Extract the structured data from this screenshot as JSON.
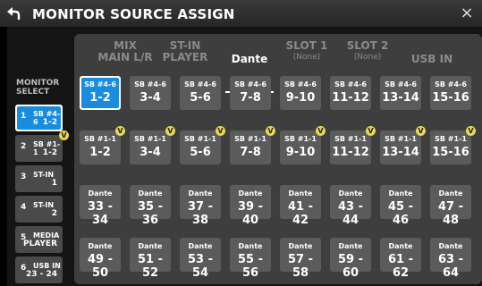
{
  "header": {
    "title": "MONITOR SOURCE ASSIGN",
    "close_glyph": "×",
    "back_icon": "back-arrow-icon"
  },
  "tabs": {
    "mix": {
      "l1": "MIX",
      "l2": "MAIN L/R"
    },
    "stin": {
      "l1": "ST-IN",
      "l2": "PLAYER"
    },
    "dante": {
      "l1": "Dante"
    },
    "slot1": {
      "l1": "SLOT 1",
      "l2": "(None)"
    },
    "slot2": {
      "l1": "SLOT 2",
      "l2": "(None)"
    },
    "usb": {
      "l1": "USB IN"
    }
  },
  "monitor_select": {
    "title_line1": "MONITOR",
    "title_line2": "SELECT",
    "items": [
      {
        "num": "1",
        "line1": "SB #4-6",
        "line2": "1-2"
      },
      {
        "num": "2",
        "line1": "SB #1-1",
        "line2": "1-2"
      },
      {
        "num": "3",
        "line1": "ST-IN",
        "line2": "1"
      },
      {
        "num": "4",
        "line1": "ST-IN",
        "line2": "2"
      },
      {
        "num": "5",
        "line1": "MEDIA",
        "line2": "PLAYER"
      },
      {
        "num": "6",
        "line1": "USB IN",
        "line2": "23 - 24"
      }
    ]
  },
  "badge": "V",
  "grid": {
    "row1": [
      {
        "top": "SB #4-6",
        "bottom": "1-2"
      },
      {
        "top": "SB #4-6",
        "bottom": "3-4"
      },
      {
        "top": "SB #4-6",
        "bottom": "5-6"
      },
      {
        "top": "SB #4-6",
        "bottom": "7-8"
      },
      {
        "top": "SB #4-6",
        "bottom": "9-10"
      },
      {
        "top": "SB #4-6",
        "bottom": "11-12"
      },
      {
        "top": "SB #4-6",
        "bottom": "13-14"
      },
      {
        "top": "SB #4-6",
        "bottom": "15-16"
      }
    ],
    "row2": [
      {
        "top": "SB #1-1",
        "bottom": "1-2"
      },
      {
        "top": "SB #1-1",
        "bottom": "3-4"
      },
      {
        "top": "SB #1-1",
        "bottom": "5-6"
      },
      {
        "top": "SB #1-1",
        "bottom": "7-8"
      },
      {
        "top": "SB #1-1",
        "bottom": "9-10"
      },
      {
        "top": "SB #1-1",
        "bottom": "11-12"
      },
      {
        "top": "SB #1-1",
        "bottom": "13-14"
      },
      {
        "top": "SB #1-1",
        "bottom": "15-16"
      }
    ],
    "row3": [
      {
        "top": "Dante",
        "bottom": "33 - 34"
      },
      {
        "top": "Dante",
        "bottom": "35 - 36"
      },
      {
        "top": "Dante",
        "bottom": "37 - 38"
      },
      {
        "top": "Dante",
        "bottom": "39 - 40"
      },
      {
        "top": "Dante",
        "bottom": "41 - 42"
      },
      {
        "top": "Dante",
        "bottom": "43 - 44"
      },
      {
        "top": "Dante",
        "bottom": "45 - 46"
      },
      {
        "top": "Dante",
        "bottom": "47 - 48"
      }
    ],
    "row4": [
      {
        "top": "Dante",
        "bottom": "49 - 50"
      },
      {
        "top": "Dante",
        "bottom": "51 - 52"
      },
      {
        "top": "Dante",
        "bottom": "53 - 54"
      },
      {
        "top": "Dante",
        "bottom": "55 - 56"
      },
      {
        "top": "Dante",
        "bottom": "57 - 58"
      },
      {
        "top": "Dante",
        "bottom": "59 - 60"
      },
      {
        "top": "Dante",
        "bottom": "61 - 62"
      },
      {
        "top": "Dante",
        "bottom": "63 - 64"
      }
    ]
  },
  "colors": {
    "accent": "#1a8ce0",
    "badge": "#e8d84a"
  }
}
